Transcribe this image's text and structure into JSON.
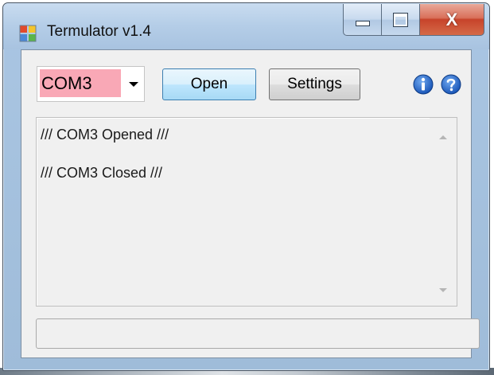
{
  "window": {
    "title": "Termulator v1.4",
    "close_glyph": "X"
  },
  "toolbar": {
    "port_selected": "COM3",
    "open_label": "Open",
    "settings_label": "Settings",
    "info_icon": "info-icon",
    "help_icon": "help-icon"
  },
  "log": {
    "lines": [
      "/// COM3 Opened ///",
      "",
      "/// COM3 Closed ///"
    ]
  },
  "input": {
    "value": ""
  },
  "colors": {
    "port_highlight": "#f9a8b6",
    "close_button": "#c7432a",
    "open_button_border": "#3c7fb1",
    "icon_blue": "#1e64c8"
  }
}
